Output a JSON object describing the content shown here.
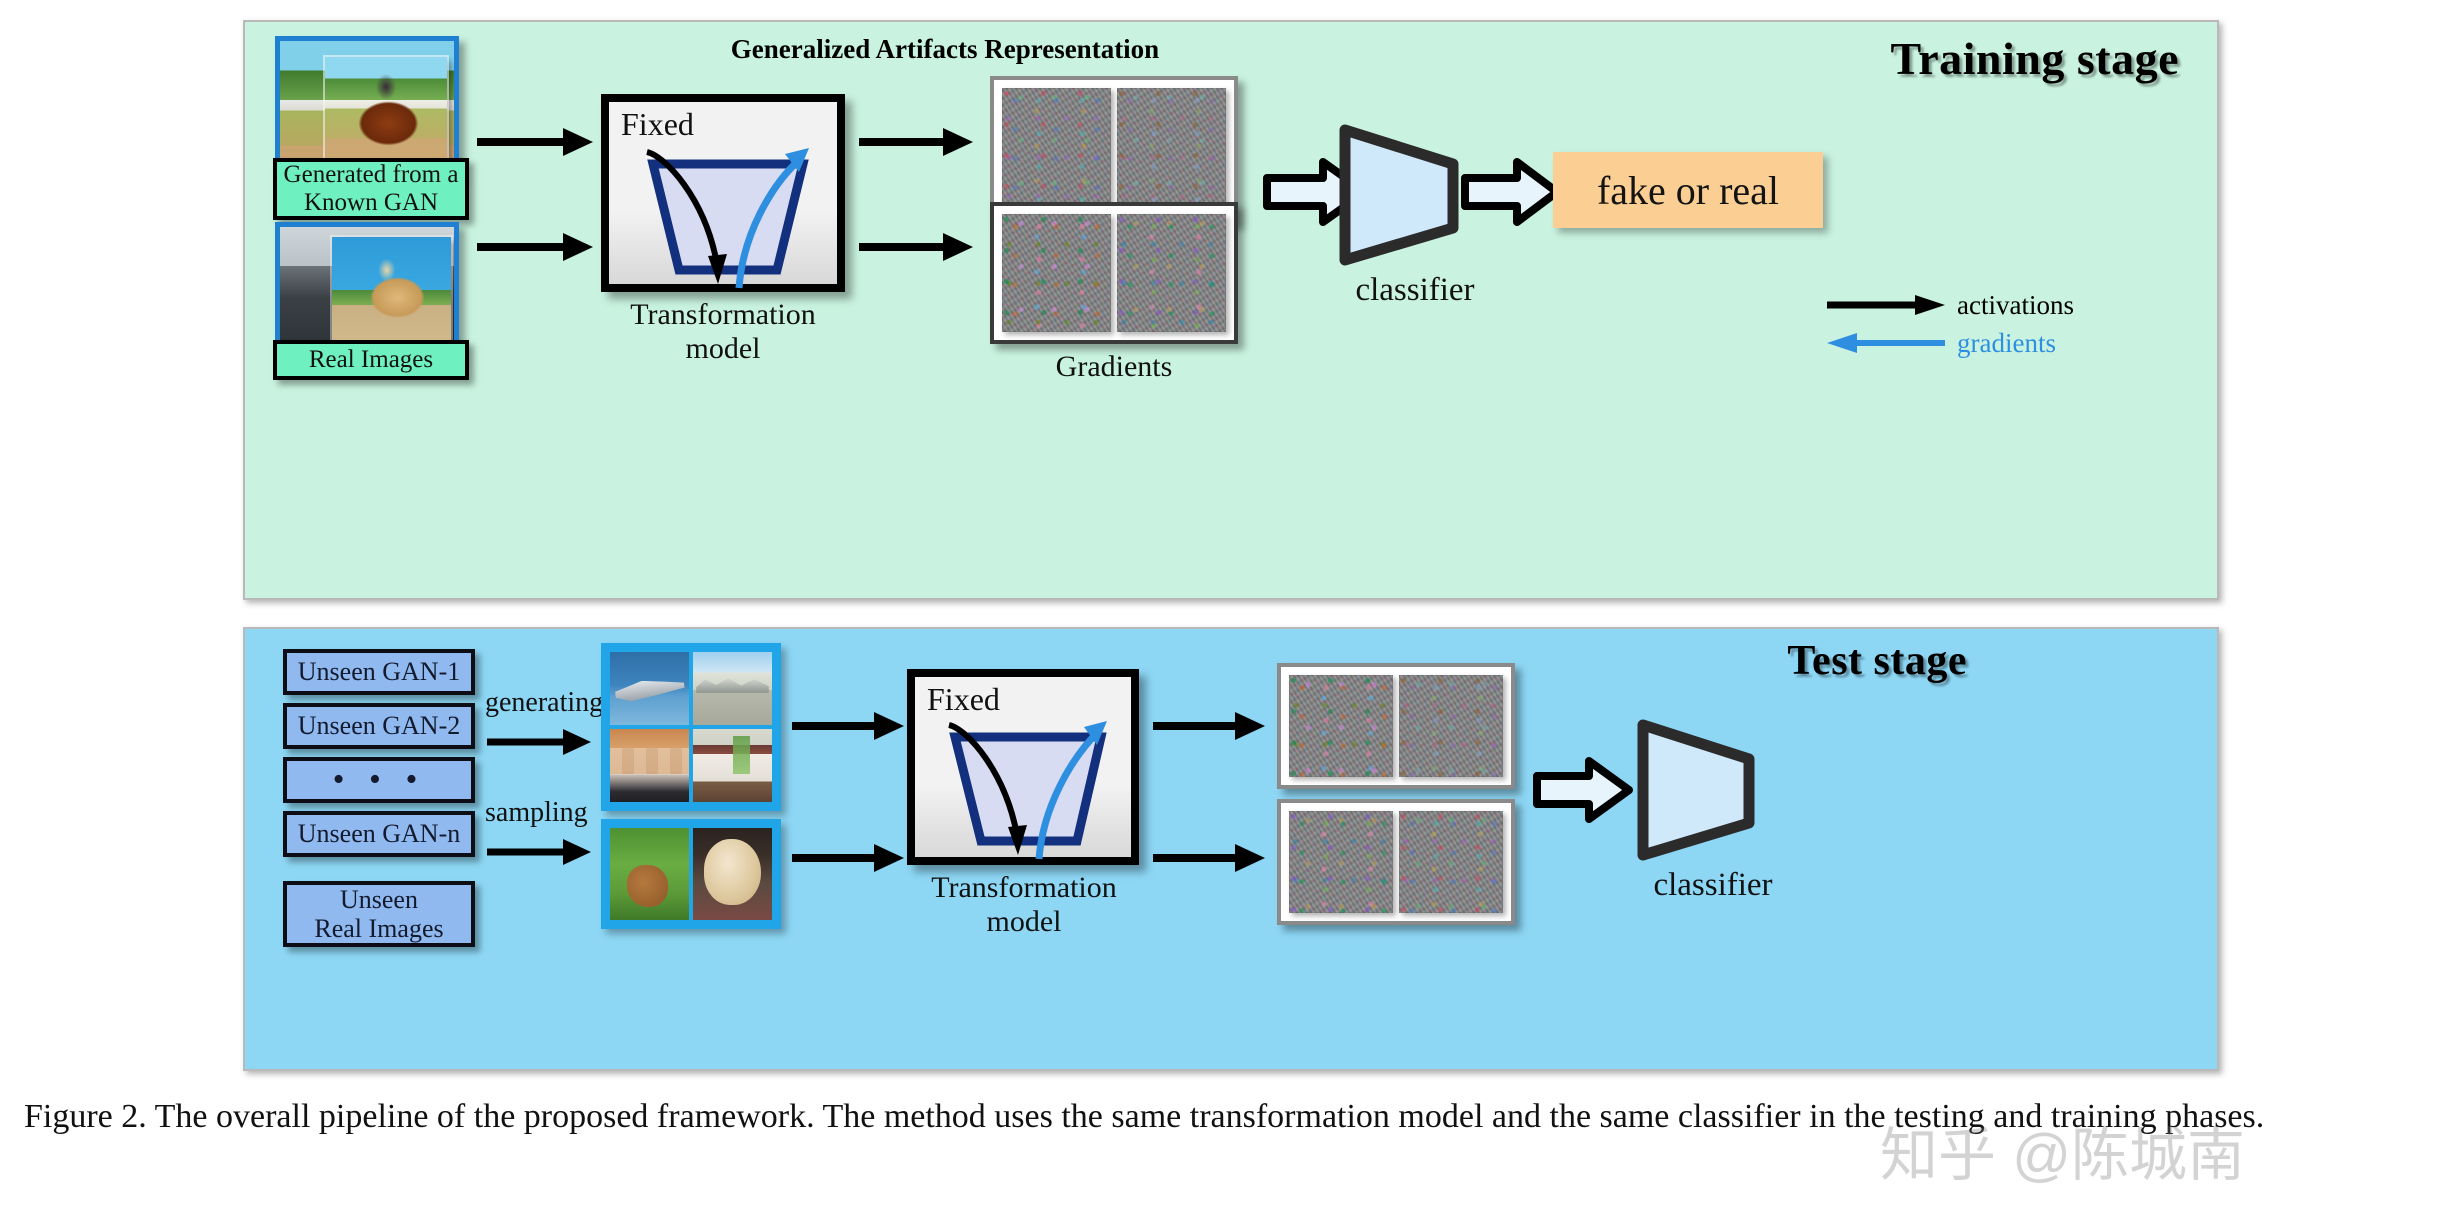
{
  "figure": {
    "caption": "Figure 2. The overall pipeline of the proposed framework. The method uses the same transformation model and the same classifier in the testing and training phases.",
    "watermark": "知乎 @陈城南"
  },
  "colors": {
    "train_panel_bg": "#c9f3e0",
    "test_panel_bg": "#8dd7f5",
    "label_box_bg": "#6ff0c0",
    "gan_box_bg": "#8fb9ef",
    "classifier_fill": "#cfe8fa",
    "output_badge_bg": "#fbcf93",
    "gradient_blue": "#2e8fe0",
    "photo_border": "#1f7fd0",
    "artifact_gray": "#848484"
  },
  "training_stage": {
    "title": "Training stage",
    "inputs": [
      {
        "label": "Generated from\na Known GAN"
      },
      {
        "label": "Real Images"
      }
    ],
    "transformation": {
      "fixed_label": "Fixed",
      "caption": "Transformation\nmodel"
    },
    "representation_title": "Generalized Artifacts Representation",
    "gradients_caption": "Gradients",
    "classifier_label": "classifier",
    "output_label": "fake or real",
    "legend": [
      {
        "label": "activations",
        "color": "#000000",
        "direction": "right"
      },
      {
        "label": "gradients",
        "color": "#2e8fe0",
        "direction": "left"
      }
    ]
  },
  "test_stage": {
    "title": "Test stage",
    "sources": [
      {
        "label": "Unseen GAN-1"
      },
      {
        "label": "Unseen GAN-2"
      },
      {
        "label": "• • •"
      },
      {
        "label": "Unseen GAN-n"
      },
      {
        "label": "Unseen\nReal Images"
      }
    ],
    "arrow_labels": [
      "generating",
      "sampling"
    ],
    "transformation": {
      "fixed_label": "Fixed",
      "caption": "Transformation\nmodel"
    },
    "classifier_label": "classifier"
  },
  "icons": {
    "activations_arrow": "arrow-right-icon",
    "gradients_arrow": "arrow-left-icon",
    "flow_arrow": "arrow-right-icon",
    "block_arrow": "block-arrow-right-icon",
    "classifier_shape": "trapezoid-icon",
    "funnel_shape": "funnel-icon"
  }
}
